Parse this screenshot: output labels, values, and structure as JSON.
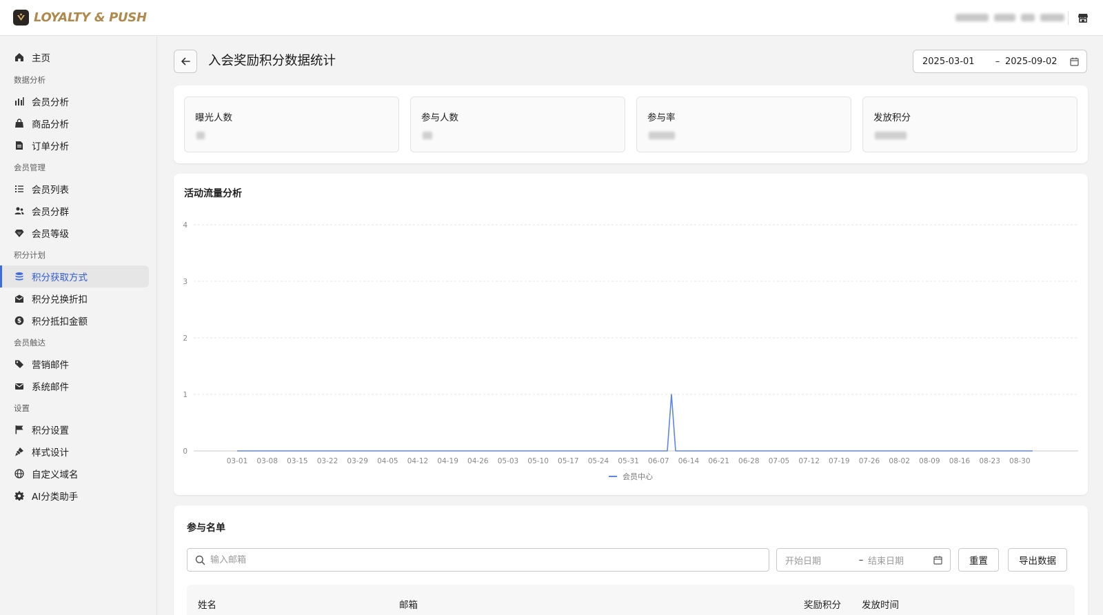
{
  "app": {
    "logo_text": "LOYALTY & PUSH"
  },
  "sidebar": {
    "home": {
      "label": "主页",
      "icon": "home-icon"
    },
    "groups": [
      {
        "title": "数据分析",
        "items": [
          {
            "label": "会员分析",
            "icon": "bar-chart-icon"
          },
          {
            "label": "商品分析",
            "icon": "shopping-bag-icon"
          },
          {
            "label": "订单分析",
            "icon": "document-icon"
          }
        ]
      },
      {
        "title": "会员管理",
        "items": [
          {
            "label": "会员列表",
            "icon": "list-icon"
          },
          {
            "label": "会员分群",
            "icon": "users-icon"
          },
          {
            "label": "会员等级",
            "icon": "diamond-icon"
          }
        ]
      },
      {
        "title": "积分计划",
        "items": [
          {
            "label": "积分获取方式",
            "icon": "database-icon"
          },
          {
            "label": "积分兑换折扣",
            "icon": "gift-mail-icon"
          },
          {
            "label": "积分抵扣金额",
            "icon": "dollar-coin-icon"
          }
        ]
      },
      {
        "title": "会员触达",
        "items": [
          {
            "label": "营销邮件",
            "icon": "tag-icon"
          },
          {
            "label": "系统邮件",
            "icon": "envelope-icon"
          }
        ]
      },
      {
        "title": "设置",
        "items": [
          {
            "label": "积分设置",
            "icon": "flag-icon"
          },
          {
            "label": "样式设计",
            "icon": "paint-brush-icon"
          },
          {
            "label": "自定义域名",
            "icon": "globe-icon"
          },
          {
            "label": "AI分类助手",
            "icon": "gear-icon"
          }
        ]
      }
    ],
    "active_item": "积分获取方式",
    "active_color": "#2f5bd8"
  },
  "page": {
    "title": "入会奖励积分数据统计",
    "date_range": {
      "start": "2025-03-01",
      "separator": "–",
      "end": "2025-09-02"
    }
  },
  "stats": [
    {
      "label": "曝光人数"
    },
    {
      "label": "参与人数"
    },
    {
      "label": "参与率"
    },
    {
      "label": "发放积分"
    }
  ],
  "chart": {
    "title": "活动流量分析"
  },
  "chart_data": {
    "type": "line",
    "title": "活动流量分析",
    "x": [
      "03-01",
      "03-08",
      "03-15",
      "03-22",
      "03-29",
      "04-05",
      "04-12",
      "04-19",
      "04-26",
      "05-03",
      "05-10",
      "05-17",
      "05-24",
      "05-31",
      "06-07",
      "06-14",
      "06-21",
      "06-28",
      "07-05",
      "07-12",
      "07-19",
      "07-26",
      "08-02",
      "08-09",
      "08-16",
      "08-23",
      "08-30"
    ],
    "x_tick_labels": [
      "03-01",
      "03-08",
      "03-15",
      "03-22",
      "03-29",
      "04-05",
      "04-12",
      "04-19",
      "04-26",
      "05-03",
      "05-10",
      "05-17",
      "05-24",
      "05-31",
      "06-07",
      "06-14",
      "06-21",
      "06-28",
      "07-05",
      "07-12",
      "07-19",
      "07-26",
      "08-02",
      "08-09",
      "08-16",
      "08-23",
      "08-30"
    ],
    "x_range": [
      "2025-03-01",
      "2025-09-02"
    ],
    "peak_date": "2025-06-10",
    "series": [
      {
        "name": "会员中心",
        "color": "#5b86e5",
        "values": [
          0,
          0,
          0,
          0,
          0,
          0,
          0,
          0,
          0,
          0,
          0,
          0,
          0,
          0,
          0,
          0,
          0,
          0,
          0,
          0,
          0,
          0,
          0,
          0,
          0,
          0,
          0
        ],
        "peak": {
          "date": "06-10",
          "value": 1
        }
      }
    ],
    "y_ticks": [
      0,
      1,
      2,
      3,
      4
    ],
    "ylim": [
      0,
      4
    ],
    "grid": true,
    "legend": "bottom-center"
  },
  "participants": {
    "title": "参与名单",
    "search_placeholder": "输入邮箱",
    "date_start_placeholder": "开始日期",
    "date_separator": "–",
    "date_end_placeholder": "结束日期",
    "reset_label": "重置",
    "export_label": "导出数据",
    "columns": [
      "姓名",
      "邮箱",
      "奖励积分",
      "发放时间"
    ]
  }
}
